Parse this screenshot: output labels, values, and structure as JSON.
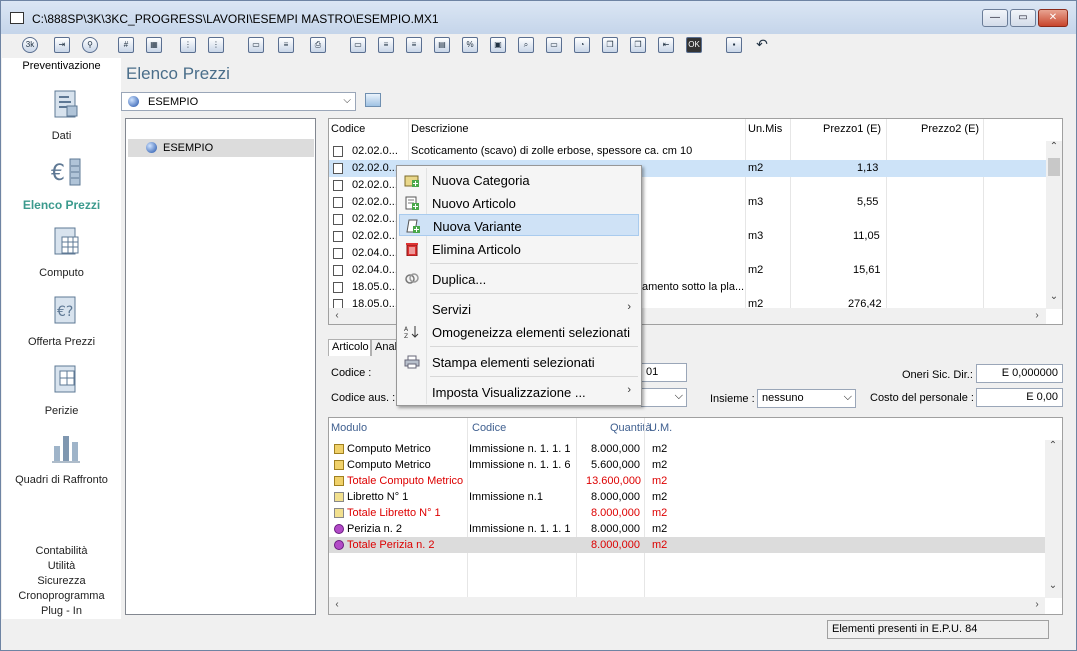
{
  "window": {
    "title": "C:\\888SP\\3K\\3KC_PROGRESS\\LAVORI\\ESEMPI MASTRO\\ESEMPIO.MX1",
    "controls": {
      "minimize": "—",
      "maximize": "▭",
      "close": "✕"
    }
  },
  "toolbar": {
    "icons": [
      "3k-logo-icon",
      "exit-icon",
      "search-icon",
      "hash-icon",
      "grid-icon",
      "tree-icon",
      "tree-add-icon",
      "new-folder-icon",
      "new-item-icon",
      "print-icon",
      "folder-icon",
      "doc-icon",
      "doc-list-icon",
      "percent-icon",
      "calc-icon",
      "preview-icon",
      "window-icon",
      "gauge-icon",
      "copy-icon",
      "copy2-icon",
      "import-icon",
      "ok-icon",
      "save-icon",
      "undo-icon"
    ],
    "labels": {
      "percent": "%",
      "ok": "OK",
      "hash": "#"
    }
  },
  "sidebar": {
    "header": "Preventivazione",
    "items": [
      {
        "label": "Dati",
        "icon": "data-icon"
      },
      {
        "label": "Elenco Prezzi",
        "icon": "euro-list-icon",
        "active": true
      },
      {
        "label": "Computo",
        "icon": "computo-icon"
      },
      {
        "label": "Offerta Prezzi",
        "icon": "offer-icon"
      },
      {
        "label": "Perizie",
        "icon": "perizie-icon"
      },
      {
        "label": "Quadri di Raffronto",
        "icon": "bar-chart-icon"
      }
    ],
    "bottom": [
      "Contabilità",
      "Utilità",
      "Sicurezza",
      "Cronoprogramma",
      "Plug - In"
    ]
  },
  "main": {
    "title": "Elenco Prezzi",
    "db_select": "ESEMPIO",
    "tree_root": "ESEMPIO"
  },
  "grid": {
    "headers": [
      "Codice",
      "Descrizione",
      "Un.Mis",
      "Prezzo1 (E)",
      "Prezzo2 (E)"
    ],
    "rows": [
      {
        "code": "02.02.0...",
        "desc": "Scoticamento (scavo) di zolle erbose, spessore ca. cm 10",
        "um": "",
        "p1": "",
        "p2": ""
      },
      {
        "code": "02.02.0...",
        "desc": "",
        "um": "m2",
        "p1": "1,13",
        "p2": ""
      },
      {
        "code": "02.02.0...",
        "desc": "",
        "um": "",
        "p1": "",
        "p2": ""
      },
      {
        "code": "02.02.0...",
        "desc": "",
        "um": "m3",
        "p1": "5,55",
        "p2": ""
      },
      {
        "code": "02.02.0...",
        "desc": "",
        "um": "",
        "p1": "",
        "p2": ""
      },
      {
        "code": "02.02.0...",
        "desc": "",
        "um": "m3",
        "p1": "11,05",
        "p2": ""
      },
      {
        "code": "02.04.0...",
        "desc": "",
        "um": "",
        "p1": "",
        "p2": ""
      },
      {
        "code": "02.04.0...",
        "desc": "",
        "um": "m2",
        "p1": "15,61",
        "p2": ""
      },
      {
        "code": "18.05.0...",
        "desc": "amento sotto la pla...",
        "um": "",
        "p1": "",
        "p2": ""
      },
      {
        "code": "18.05.0...",
        "desc": "",
        "um": "m2",
        "p1": "276,42",
        "p2": ""
      }
    ]
  },
  "tabs": [
    "Articolo",
    "Anal"
  ],
  "form": {
    "codice_label": "Codice :",
    "codice_value": "01",
    "codice_aus_label": "Codice aus. :",
    "insieme_label": "Insieme :",
    "insieme_value": "nessuno",
    "oneri_label": "Oneri Sic. Dir.:",
    "oneri_value": "E  0,000000",
    "costo_label": "Costo del personale :",
    "costo_value": "E  0,00"
  },
  "modules": {
    "headers": [
      "Modulo",
      "Codice",
      "Quantità",
      "U.M."
    ],
    "rows": [
      {
        "modulo": "Computo Metrico",
        "codice": "Immissione n. 1. 1. 1",
        "qta": "8.000,000",
        "um": "m2",
        "total": false,
        "icon": "computo-row-icon"
      },
      {
        "modulo": "Computo Metrico",
        "codice": "Immissione n. 1. 1. 6",
        "qta": "5.600,000",
        "um": "m2",
        "total": false,
        "icon": "computo-row-icon"
      },
      {
        "modulo": "Totale Computo Metrico",
        "codice": "",
        "qta": "13.600,000",
        "um": "m2",
        "total": true,
        "icon": "computo-row-icon"
      },
      {
        "modulo": "Libretto N° 1",
        "codice": "Immissione n.1",
        "qta": "8.000,000",
        "um": "m2",
        "total": false,
        "icon": "libretto-row-icon"
      },
      {
        "modulo": "Totale Libretto N° 1",
        "codice": "",
        "qta": "8.000,000",
        "um": "m2",
        "total": true,
        "icon": "libretto-row-icon"
      },
      {
        "modulo": "Perizia n. 2",
        "codice": "Immissione n. 1. 1. 1",
        "qta": "8.000,000",
        "um": "m2",
        "total": false,
        "icon": "perizia-row-icon"
      },
      {
        "modulo": "Totale Perizia n. 2",
        "codice": "",
        "qta": "8.000,000",
        "um": "m2",
        "total": true,
        "icon": "perizia-row-icon"
      }
    ]
  },
  "context_menu": {
    "items": [
      {
        "label": "Nuova Categoria",
        "icon": "new-category-icon"
      },
      {
        "label": "Nuovo Articolo",
        "icon": "new-article-icon"
      },
      {
        "label": "Nuova Variante",
        "icon": "new-variant-icon",
        "highlight": true
      },
      {
        "label": "Elimina Articolo",
        "icon": "trash-icon"
      },
      {
        "label": "Duplica...",
        "icon": "duplicate-icon"
      },
      {
        "label": "Servizi",
        "submenu": true
      },
      {
        "label": "Omogeneizza elementi selezionati",
        "icon": "sort-az-icon"
      },
      {
        "label": "Stampa elementi selezionati",
        "icon": "print-icon"
      },
      {
        "label": "Imposta Visualizzazione ...",
        "submenu": true
      }
    ],
    "submenu_arrow": "›"
  },
  "status": {
    "text": "Elementi presenti in E.P.U. 84"
  },
  "colors": {
    "accent": "#3b9a8d",
    "total_red": "#dd0000",
    "selection": "#cde3f8"
  }
}
